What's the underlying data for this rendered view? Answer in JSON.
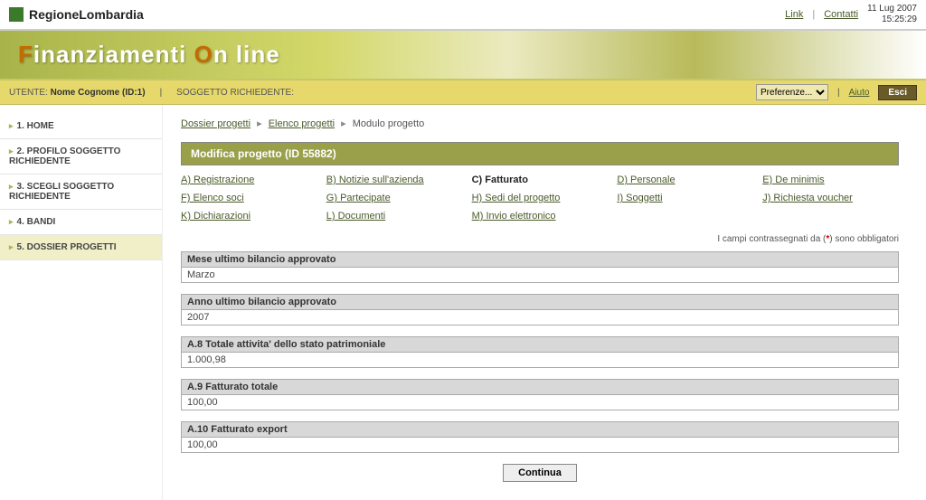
{
  "brand": "RegioneLombardia",
  "top_links": {
    "link": "Link",
    "contatti": "Contatti"
  },
  "date_line": "11 Lug 2007",
  "time_line": "15:25:29",
  "banner_html": "Finanziamenti On line",
  "userbar": {
    "utente_label": "UTENTE:",
    "utente_value": "Nome Cognome (ID:1)",
    "soggetto_label": "SOGGETTO RICHIEDENTE:",
    "preferenze_label": "Preferenze...",
    "aiuto": "Aiuto",
    "esci": "Esci"
  },
  "sidebar": [
    {
      "label": "1. HOME",
      "active": false
    },
    {
      "label": "2. PROFILO SOGGETTO RICHIEDENTE",
      "active": false
    },
    {
      "label": "3. SCEGLI SOGGETTO RICHIEDENTE",
      "active": false
    },
    {
      "label": "4. BANDI",
      "active": false
    },
    {
      "label": "5. DOSSIER PROGETTI",
      "active": true
    }
  ],
  "breadcrumb": {
    "a": "Dossier progetti",
    "b": "Elenco progetti",
    "c": "Modulo progetto"
  },
  "section_title": "Modifica progetto (ID 55882)",
  "tabs": [
    {
      "label": "A) Registrazione",
      "active": false
    },
    {
      "label": "B) Notizie sull'azienda",
      "active": false
    },
    {
      "label": "C) Fatturato",
      "active": true
    },
    {
      "label": "D) Personale",
      "active": false
    },
    {
      "label": "E) De minimis",
      "active": false
    },
    {
      "label": "F) Elenco soci",
      "active": false
    },
    {
      "label": "G) Partecipate",
      "active": false
    },
    {
      "label": "H) Sedi del progetto",
      "active": false
    },
    {
      "label": "I) Soggetti",
      "active": false
    },
    {
      "label": "J) Richiesta voucher",
      "active": false
    },
    {
      "label": "K) Dichiarazioni",
      "active": false
    },
    {
      "label": "L) Documenti",
      "active": false
    },
    {
      "label": "M) Invio elettronico",
      "active": false
    }
  ],
  "required_note_pre": "I campi contrassegnati da (",
  "required_note_ast": "*",
  "required_note_post": ") sono obbligatori",
  "fields": [
    {
      "label": "Mese ultimo bilancio approvato",
      "value": "Marzo"
    },
    {
      "label": "Anno ultimo bilancio approvato",
      "value": "2007"
    },
    {
      "label": "A.8 Totale attivita' dello stato patrimoniale",
      "value": "1.000,98"
    },
    {
      "label": "A.9 Fatturato totale",
      "value": "100,00"
    },
    {
      "label": "A.10 Fatturato export",
      "value": "100,00"
    }
  ],
  "continue_label": "Continua"
}
